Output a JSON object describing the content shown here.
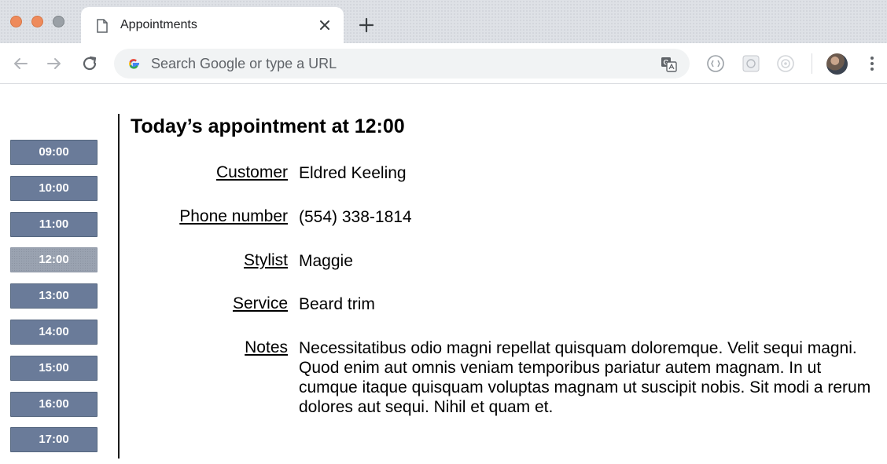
{
  "browser": {
    "tab": {
      "title": "Appointments"
    },
    "omnibox": {
      "placeholder": "Search Google or type a URL"
    }
  },
  "time_slots": [
    {
      "label": "09:00"
    },
    {
      "label": "10:00"
    },
    {
      "label": "11:00"
    },
    {
      "label": "12:00",
      "selected": true
    },
    {
      "label": "13:00"
    },
    {
      "label": "14:00"
    },
    {
      "label": "15:00"
    },
    {
      "label": "16:00"
    },
    {
      "label": "17:00"
    }
  ],
  "appointment": {
    "heading": "Today’s appointment at 12:00",
    "fields": {
      "customer": {
        "label": "Customer",
        "value": "Eldred Keeling"
      },
      "phone": {
        "label": "Phone number",
        "value": "(554) 338-1814"
      },
      "stylist": {
        "label": "Stylist",
        "value": "Maggie"
      },
      "service": {
        "label": "Service",
        "value": "Beard trim"
      },
      "notes": {
        "label": "Notes",
        "value": "Necessitatibus odio magni repellat quisquam doloremque. Velit sequi magni. Quod enim aut omnis veniam temporibus pariatur autem magnam. In ut cumque itaque quisquam voluptas magnam ut suscipit nobis. Sit modi a rerum dolores aut sequi. Nihil et quam et."
      }
    }
  },
  "colors": {
    "slot_button": "#6a7b99",
    "slot_selected": "#9aa3b1",
    "tabstrip": "#dee1e6",
    "omnibox": "#f1f3f4"
  }
}
